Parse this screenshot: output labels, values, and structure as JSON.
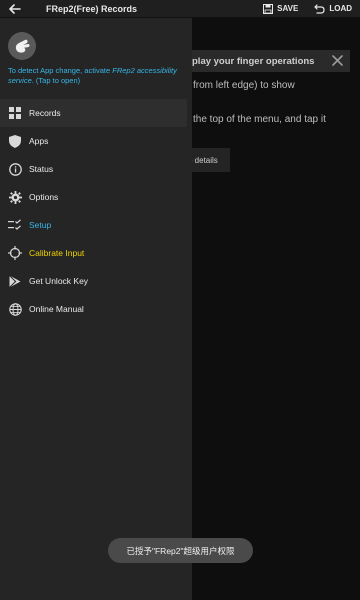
{
  "appbar": {
    "title": "FRep2(Free) Records",
    "save_label": "SAVE",
    "load_label": "LOAD"
  },
  "background": {
    "banner_text": "play your finger operations",
    "line1": "from left edge) to show",
    "line2": "the top of the menu, and tap it",
    "detail_button": "p details"
  },
  "drawer": {
    "notice_part1": "To detect App change, activate ",
    "notice_italic1": "FRep2 accessibility service",
    "notice_part2": ". (Tap to open)",
    "items": [
      {
        "label": "Records",
        "icon": "grid-icon"
      },
      {
        "label": "Apps",
        "icon": "shield-icon"
      },
      {
        "label": "Status",
        "icon": "info-icon"
      },
      {
        "label": "Options",
        "icon": "gear-icon"
      },
      {
        "label": "Setup",
        "icon": "checklist-icon"
      },
      {
        "label": "Calibrate Input",
        "icon": "crosshair-icon"
      },
      {
        "label": "Get Unlock Key",
        "icon": "play-store-icon"
      },
      {
        "label": "Online Manual",
        "icon": "globe-icon"
      }
    ]
  },
  "toast": {
    "text": "已授予\"FRep2\"超级用户权限"
  },
  "colors": {
    "accent_blue": "#38b6e8",
    "accent_yellow": "#f2d400",
    "drawer_bg": "#252525"
  }
}
